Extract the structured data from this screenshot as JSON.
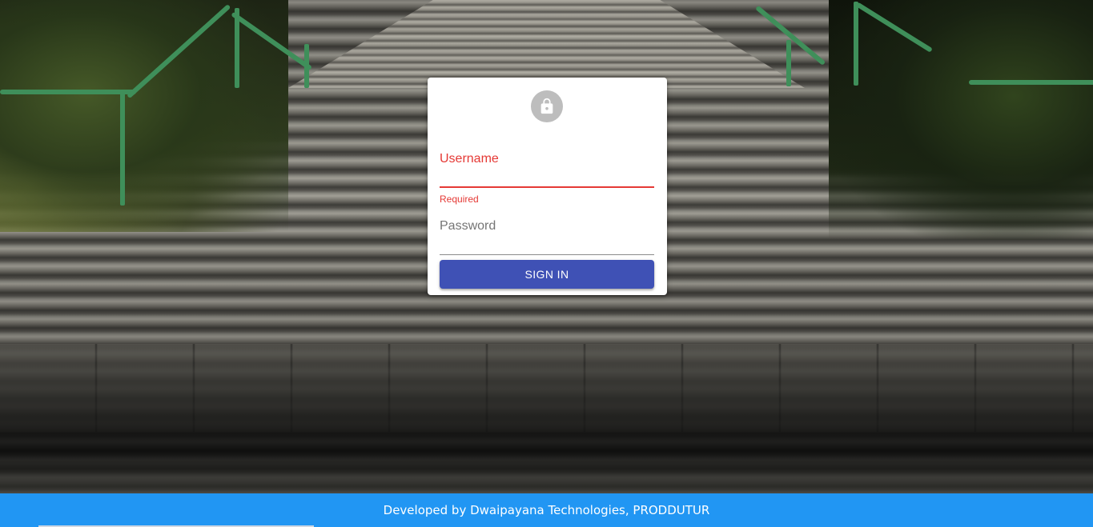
{
  "login": {
    "username_label": "Username",
    "username_value": "",
    "username_helper": "Required",
    "password_label": "Password",
    "password_value": "",
    "signin_label": "SIGN IN"
  },
  "footer": {
    "text": "Developed by Dwaipayana Technologies, PRODDUTUR"
  },
  "icons": {
    "avatar_icon": "lock-icon"
  },
  "colors": {
    "error": "#e53935",
    "primary_button": "#3f51b5",
    "footer_bg": "#2196f3",
    "avatar_bg": "#bdbdbd"
  }
}
